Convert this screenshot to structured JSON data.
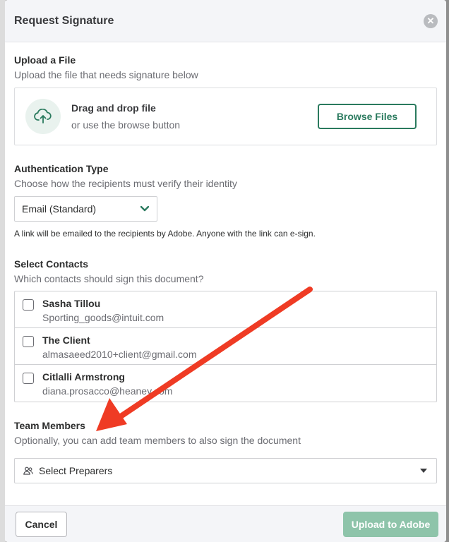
{
  "modal": {
    "title": "Request Signature",
    "close_icon": "close-icon"
  },
  "upload": {
    "title": "Upload a File",
    "subtitle": "Upload the file that needs signature below",
    "drag_label": "Drag and drop file",
    "browse_hint": "or use the browse button",
    "browse_button": "Browse Files",
    "icon": "cloud-upload-icon"
  },
  "auth": {
    "title": "Authentication Type",
    "subtitle": "Choose how the recipients must verify their identity",
    "selected": "Email (Standard)",
    "note": "A link will be emailed to the recipients by Adobe. Anyone with the link can e-sign."
  },
  "contacts": {
    "title": "Select Contacts",
    "subtitle": "Which contacts should sign this document?",
    "items": [
      {
        "name": "Sasha Tillou",
        "email": "Sporting_goods@intuit.com"
      },
      {
        "name": "The Client",
        "email": "almasaeed2010+client@gmail.com"
      },
      {
        "name": "Citlalli Armstrong",
        "email": "diana.prosacco@heaney.com"
      }
    ]
  },
  "team": {
    "title": "Team Members",
    "subtitle": "Optionally, you can add team members to also sign the document",
    "placeholder": "Select Preparers"
  },
  "footer": {
    "cancel": "Cancel",
    "submit": "Upload to Adobe"
  },
  "colors": {
    "accent": "#2a7a5e",
    "accent_disabled": "#8ec4aa",
    "annotation_arrow": "#ef3b24"
  }
}
